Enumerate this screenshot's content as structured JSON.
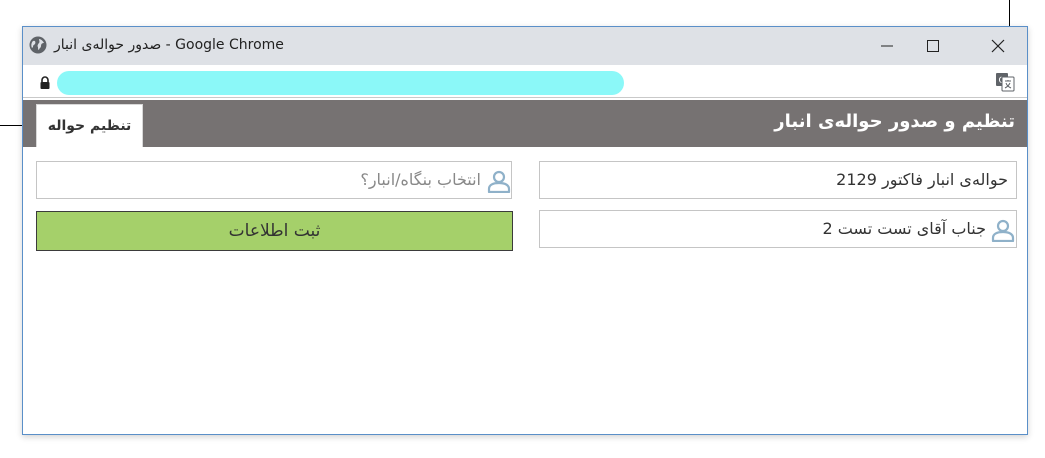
{
  "window": {
    "title": "صدور حواله‌ی انبار - Google Chrome"
  },
  "address_bar": {
    "url_value": ""
  },
  "header": {
    "title": "تنظیم و صدور حواله‌ی انبار",
    "tab_label": "تنظیم حواله"
  },
  "form": {
    "invoice_value": "حواله‌ی انبار فاکتور 2129",
    "person_value": "جناب آقای تست تست 2",
    "warehouse_placeholder": "انتخاب بنگاه/انبار؟",
    "submit_label": "ثبت اطلاعات"
  },
  "colors": {
    "titlebar": "#dee1e6",
    "url_highlight": "#8bf8f8",
    "header_bg": "#767272",
    "submit_bg": "#a5d06a",
    "user_icon": "#8fb1c9"
  },
  "icons": [
    "globe-icon",
    "minimize-icon",
    "maximize-icon",
    "close-icon",
    "lock-icon",
    "translate-icon",
    "user-icon"
  ]
}
